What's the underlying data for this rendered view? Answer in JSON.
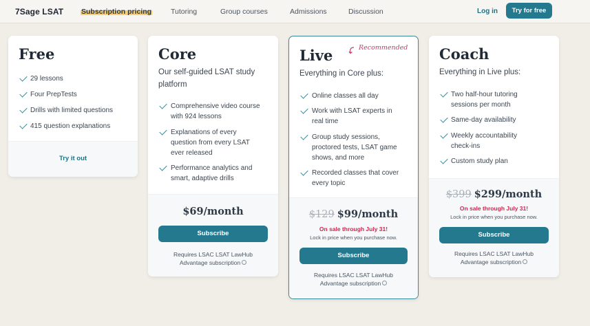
{
  "header": {
    "logo": "7Sage LSAT",
    "nav": [
      "Subscription pricing",
      "Tutoring",
      "Group courses",
      "Admissions",
      "Discussion"
    ],
    "login": "Log in",
    "cta": "Try for free"
  },
  "colors": {
    "accent": "#24798e",
    "sale": "#d2254f",
    "highlight": "#f6cf74",
    "recommended": "#c33d6a"
  },
  "plans": {
    "free": {
      "name": "Free",
      "features": [
        "29 lessons",
        "Four PrepTests",
        "Drills with limited questions",
        "415 question explanations"
      ],
      "action": "Try it out"
    },
    "core": {
      "name": "Core",
      "desc": [
        "Our self-guided LSAT study",
        "platform"
      ],
      "features": [
        [
          "Comprehensive video course",
          "with 924 lessons"
        ],
        [
          "Explanations of every",
          "question from every LSAT",
          "ever released"
        ],
        [
          "Performance analytics and",
          "smart, adaptive drills"
        ]
      ],
      "price": "$69/month",
      "button": "Subscribe",
      "requires": [
        "Requires LSAC LSAT LawHub",
        "Advantage subscription"
      ]
    },
    "live": {
      "name": "Live",
      "badge": "Recommended",
      "desc": "Everything in Core plus:",
      "features": [
        [
          "Online classes all day"
        ],
        [
          "Work with LSAT experts in",
          "real time"
        ],
        [
          "Group study sessions,",
          "proctored tests, LSAT game",
          "shows, and more"
        ],
        [
          "Recorded classes that cover",
          "every topic"
        ]
      ],
      "old_price": "$129",
      "price": "$99/month",
      "sale": "On sale through July 31!",
      "lock": "Lock in price when you purchase now.",
      "button": "Subscribe",
      "requires": [
        "Requires LSAC LSAT LawHub",
        "Advantage subscription"
      ]
    },
    "coach": {
      "name": "Coach",
      "desc": "Everything in Live plus:",
      "features": [
        [
          "Two half-hour tutoring",
          "sessions per month"
        ],
        [
          "Same-day availability"
        ],
        [
          "Weekly accountability",
          "check-ins"
        ],
        [
          "Custom study plan"
        ]
      ],
      "old_price": "$399",
      "price": "$299/month",
      "sale": "On sale through July 31!",
      "lock": "Lock in price when you purchase now.",
      "button": "Subscribe",
      "requires": [
        "Requires LSAC LSAT LawHub",
        "Advantage subscription"
      ]
    }
  }
}
